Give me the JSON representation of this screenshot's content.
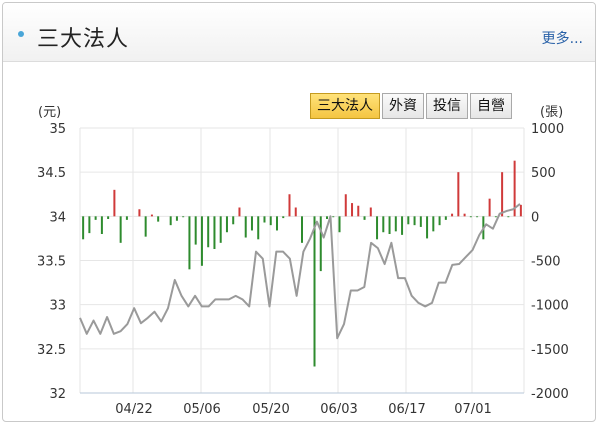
{
  "widget": {
    "title": "三大法人",
    "more_label": "更多..."
  },
  "tabs": [
    {
      "label": "三大法人",
      "active": true
    },
    {
      "label": "外資",
      "active": false
    },
    {
      "label": "投信",
      "active": false
    },
    {
      "label": "自營",
      "active": false
    }
  ],
  "colors": {
    "accent": "#4aa6d8",
    "buy": "#d03a3a",
    "sell": "#2e8b2e",
    "price": "#9a9a9a",
    "tab_active": "#f4c542"
  },
  "chart_data": {
    "type": "bar",
    "left_unit": "(元)",
    "right_unit": "(張)",
    "left_axis": {
      "min": 32,
      "max": 35,
      "ticks": [
        "35",
        "34.5",
        "34",
        "33.5",
        "33",
        "32.5",
        "32"
      ]
    },
    "right_axis": {
      "min": -2000,
      "max": 1000,
      "ticks": [
        "1000",
        "500",
        "0",
        "-500",
        "-1000",
        "-1500",
        "-2000"
      ]
    },
    "x_tick_labels": [
      "04/22",
      "05/06",
      "05/20",
      "06/03",
      "06/17",
      "07/01"
    ],
    "series": [
      {
        "kind": "bar",
        "values": [
          -260,
          -190,
          -40,
          -200,
          -30,
          300,
          -300,
          -40,
          0,
          80,
          -230,
          20,
          -60,
          0,
          -100,
          -50,
          -10,
          -600,
          -320,
          -560,
          -350,
          -370,
          -300,
          -180,
          -90,
          100,
          -240,
          -160,
          -260,
          -70,
          -100,
          -160,
          -20,
          250,
          100,
          -300,
          0,
          -1700,
          -620,
          -30,
          -10,
          -180,
          250,
          150,
          120,
          -40,
          100,
          -260,
          -180,
          -200,
          -170,
          -210,
          -90,
          -100,
          -120,
          -250,
          -170,
          -100,
          -40,
          30,
          500,
          30,
          -10,
          -10,
          -260,
          200,
          -10,
          500,
          -10,
          630,
          130
        ]
      },
      {
        "kind": "line",
        "values": [
          32.85,
          32.67,
          32.82,
          32.67,
          32.86,
          32.67,
          32.7,
          32.78,
          32.96,
          32.79,
          32.85,
          32.92,
          32.81,
          32.96,
          33.28,
          33.1,
          32.98,
          33.1,
          32.98,
          32.98,
          33.06,
          33.06,
          33.06,
          33.1,
          33.06,
          32.98,
          33.6,
          33.52,
          32.98,
          33.6,
          33.6,
          33.52,
          33.1,
          33.6,
          33.75,
          33.94,
          33.76,
          34,
          32.62,
          32.78,
          33.16,
          33.16,
          33.2,
          33.7,
          33.64,
          33.46,
          33.7,
          33.3,
          33.3,
          33.1,
          33.02,
          32.98,
          33.02,
          33.25,
          33.25,
          33.45,
          33.46,
          33.54,
          33.62,
          33.79,
          33.91,
          33.86,
          34.03,
          34.06,
          34.08,
          34.14
        ]
      }
    ]
  }
}
